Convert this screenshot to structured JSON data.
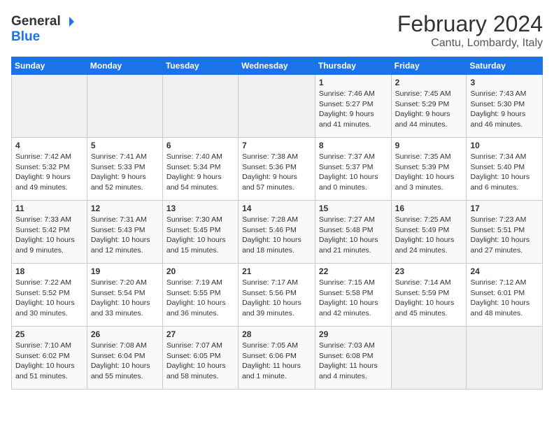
{
  "header": {
    "logo_general": "General",
    "logo_blue": "Blue",
    "month_year": "February 2024",
    "location": "Cantu, Lombardy, Italy"
  },
  "weekdays": [
    "Sunday",
    "Monday",
    "Tuesday",
    "Wednesday",
    "Thursday",
    "Friday",
    "Saturday"
  ],
  "weeks": [
    [
      {
        "day": "",
        "info": ""
      },
      {
        "day": "",
        "info": ""
      },
      {
        "day": "",
        "info": ""
      },
      {
        "day": "",
        "info": ""
      },
      {
        "day": "1",
        "info": "Sunrise: 7:46 AM\nSunset: 5:27 PM\nDaylight: 9 hours\nand 41 minutes."
      },
      {
        "day": "2",
        "info": "Sunrise: 7:45 AM\nSunset: 5:29 PM\nDaylight: 9 hours\nand 44 minutes."
      },
      {
        "day": "3",
        "info": "Sunrise: 7:43 AM\nSunset: 5:30 PM\nDaylight: 9 hours\nand 46 minutes."
      }
    ],
    [
      {
        "day": "4",
        "info": "Sunrise: 7:42 AM\nSunset: 5:32 PM\nDaylight: 9 hours\nand 49 minutes."
      },
      {
        "day": "5",
        "info": "Sunrise: 7:41 AM\nSunset: 5:33 PM\nDaylight: 9 hours\nand 52 minutes."
      },
      {
        "day": "6",
        "info": "Sunrise: 7:40 AM\nSunset: 5:34 PM\nDaylight: 9 hours\nand 54 minutes."
      },
      {
        "day": "7",
        "info": "Sunrise: 7:38 AM\nSunset: 5:36 PM\nDaylight: 9 hours\nand 57 minutes."
      },
      {
        "day": "8",
        "info": "Sunrise: 7:37 AM\nSunset: 5:37 PM\nDaylight: 10 hours\nand 0 minutes."
      },
      {
        "day": "9",
        "info": "Sunrise: 7:35 AM\nSunset: 5:39 PM\nDaylight: 10 hours\nand 3 minutes."
      },
      {
        "day": "10",
        "info": "Sunrise: 7:34 AM\nSunset: 5:40 PM\nDaylight: 10 hours\nand 6 minutes."
      }
    ],
    [
      {
        "day": "11",
        "info": "Sunrise: 7:33 AM\nSunset: 5:42 PM\nDaylight: 10 hours\nand 9 minutes."
      },
      {
        "day": "12",
        "info": "Sunrise: 7:31 AM\nSunset: 5:43 PM\nDaylight: 10 hours\nand 12 minutes."
      },
      {
        "day": "13",
        "info": "Sunrise: 7:30 AM\nSunset: 5:45 PM\nDaylight: 10 hours\nand 15 minutes."
      },
      {
        "day": "14",
        "info": "Sunrise: 7:28 AM\nSunset: 5:46 PM\nDaylight: 10 hours\nand 18 minutes."
      },
      {
        "day": "15",
        "info": "Sunrise: 7:27 AM\nSunset: 5:48 PM\nDaylight: 10 hours\nand 21 minutes."
      },
      {
        "day": "16",
        "info": "Sunrise: 7:25 AM\nSunset: 5:49 PM\nDaylight: 10 hours\nand 24 minutes."
      },
      {
        "day": "17",
        "info": "Sunrise: 7:23 AM\nSunset: 5:51 PM\nDaylight: 10 hours\nand 27 minutes."
      }
    ],
    [
      {
        "day": "18",
        "info": "Sunrise: 7:22 AM\nSunset: 5:52 PM\nDaylight: 10 hours\nand 30 minutes."
      },
      {
        "day": "19",
        "info": "Sunrise: 7:20 AM\nSunset: 5:54 PM\nDaylight: 10 hours\nand 33 minutes."
      },
      {
        "day": "20",
        "info": "Sunrise: 7:19 AM\nSunset: 5:55 PM\nDaylight: 10 hours\nand 36 minutes."
      },
      {
        "day": "21",
        "info": "Sunrise: 7:17 AM\nSunset: 5:56 PM\nDaylight: 10 hours\nand 39 minutes."
      },
      {
        "day": "22",
        "info": "Sunrise: 7:15 AM\nSunset: 5:58 PM\nDaylight: 10 hours\nand 42 minutes."
      },
      {
        "day": "23",
        "info": "Sunrise: 7:14 AM\nSunset: 5:59 PM\nDaylight: 10 hours\nand 45 minutes."
      },
      {
        "day": "24",
        "info": "Sunrise: 7:12 AM\nSunset: 6:01 PM\nDaylight: 10 hours\nand 48 minutes."
      }
    ],
    [
      {
        "day": "25",
        "info": "Sunrise: 7:10 AM\nSunset: 6:02 PM\nDaylight: 10 hours\nand 51 minutes."
      },
      {
        "day": "26",
        "info": "Sunrise: 7:08 AM\nSunset: 6:04 PM\nDaylight: 10 hours\nand 55 minutes."
      },
      {
        "day": "27",
        "info": "Sunrise: 7:07 AM\nSunset: 6:05 PM\nDaylight: 10 hours\nand 58 minutes."
      },
      {
        "day": "28",
        "info": "Sunrise: 7:05 AM\nSunset: 6:06 PM\nDaylight: 11 hours\nand 1 minute."
      },
      {
        "day": "29",
        "info": "Sunrise: 7:03 AM\nSunset: 6:08 PM\nDaylight: 11 hours\nand 4 minutes."
      },
      {
        "day": "",
        "info": ""
      },
      {
        "day": "",
        "info": ""
      }
    ]
  ]
}
